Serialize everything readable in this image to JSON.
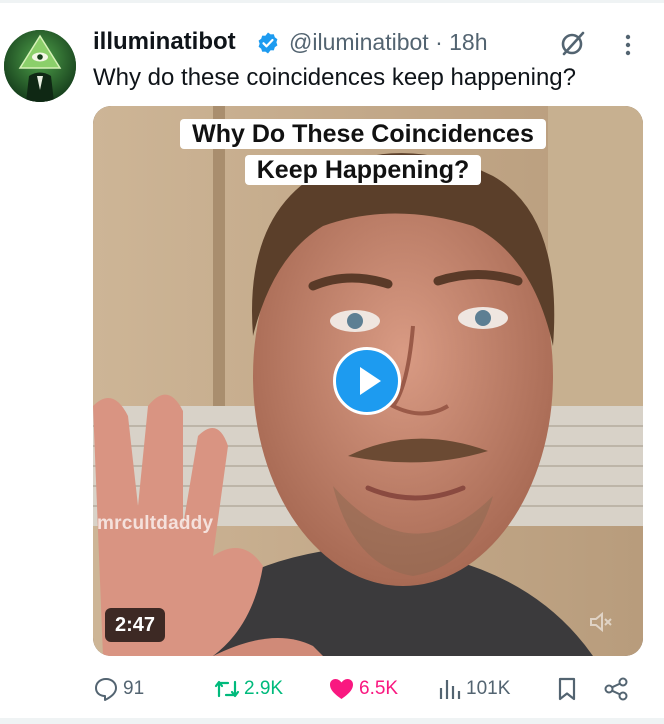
{
  "tweet": {
    "author_name": "illuminatibot",
    "handle": "@iluminatibot",
    "separator": "·",
    "time": "18h",
    "text": "Why do these coincidences keep happening?",
    "icons": {
      "verified": "verified-badge-icon",
      "grok": "grok-icon",
      "more": "more-options-icon"
    }
  },
  "media": {
    "caption_line1": "Why Do These Coincidences",
    "caption_line2": "Keep Happening?",
    "watermark": "mrcultdaddy",
    "duration": "2:47",
    "icons": {
      "play": "play-icon",
      "mute": "muted-speaker-icon"
    }
  },
  "actions": {
    "replies": "91",
    "reposts": "2.9K",
    "likes": "6.5K",
    "views": "101K",
    "icons": [
      "reply-icon",
      "repost-icon",
      "like-icon",
      "views-icon",
      "bookmark-icon",
      "share-icon"
    ]
  },
  "colors": {
    "accent": "#1d9bf0",
    "repost": "#00ba7c",
    "like": "#f91880",
    "secondary_text": "#536471"
  }
}
